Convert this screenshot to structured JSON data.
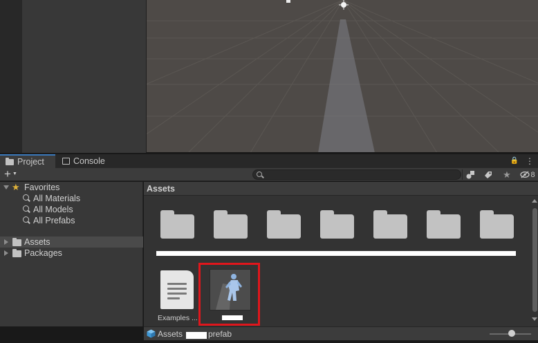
{
  "tabs": [
    {
      "label": "Project",
      "icon": "folder-icon",
      "active": true
    },
    {
      "label": "Console",
      "icon": "console-icon",
      "active": false
    }
  ],
  "tab_tools": {
    "lock": "🔒",
    "menu": "⋮"
  },
  "toolbar": {
    "add_label": "+",
    "search_placeholder": "",
    "hidden_count": "8"
  },
  "tree": {
    "favorites_label": "Favorites",
    "favorites": [
      "All Materials",
      "All Models",
      "All Prefabs"
    ],
    "roots": [
      {
        "label": "Assets",
        "selected": true
      },
      {
        "label": "Packages",
        "selected": false
      }
    ]
  },
  "content": {
    "header": "Assets",
    "folder_count": 7,
    "items": [
      {
        "label": "Examples ...",
        "type": "text-asset"
      },
      {
        "label": "",
        "type": "prefab"
      }
    ]
  },
  "status": {
    "path_root": "Assets",
    "path_suffix": "prefab"
  },
  "colors": {
    "highlight": "#e0161c",
    "accent": "#3a79bb",
    "star": "#e0b33a"
  }
}
